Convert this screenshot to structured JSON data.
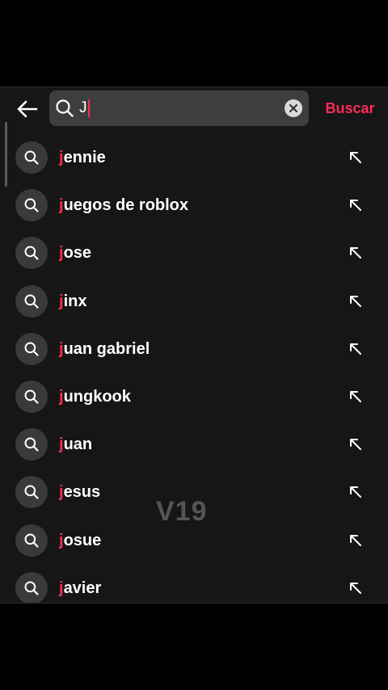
{
  "header": {
    "search_value": "J",
    "search_button_label": "Buscar"
  },
  "suggestions": [
    {
      "highlight": "j",
      "rest": "ennie"
    },
    {
      "highlight": "j",
      "rest": "uegos de roblox"
    },
    {
      "highlight": "j",
      "rest": "ose"
    },
    {
      "highlight": "j",
      "rest": "inx"
    },
    {
      "highlight": "j",
      "rest": "uan gabriel"
    },
    {
      "highlight": "j",
      "rest": "ungkook"
    },
    {
      "highlight": "j",
      "rest": "uan"
    },
    {
      "highlight": "j",
      "rest": "esus"
    },
    {
      "highlight": "j",
      "rest": "osue"
    },
    {
      "highlight": "j",
      "rest": "avier"
    }
  ],
  "watermark": "V19",
  "icons": {
    "back": "arrow-left-icon",
    "search": "search-icon",
    "clear": "close-icon",
    "fill": "arrow-up-left-icon"
  },
  "colors": {
    "accent": "#fe2c55",
    "background": "#161616",
    "search_box": "#3e3e3e"
  }
}
